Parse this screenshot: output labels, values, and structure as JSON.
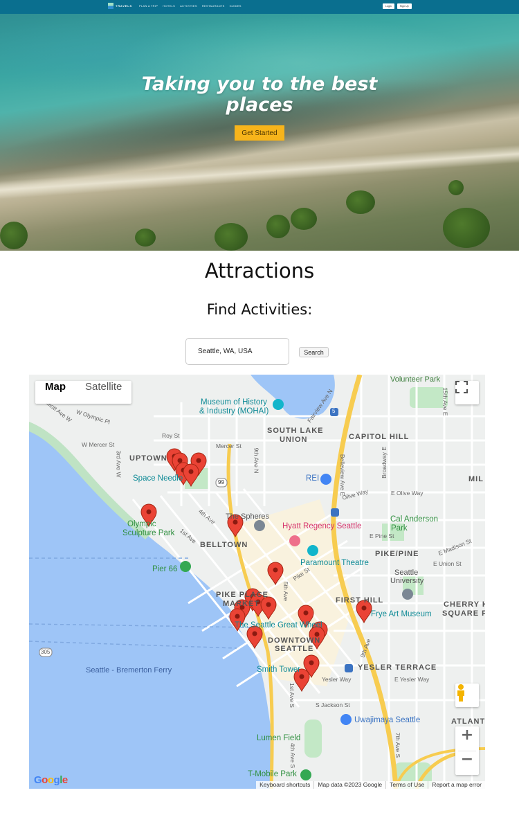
{
  "nav": {
    "brand": "TRAVELS",
    "links": [
      "PLAN A TRIP",
      "HOTELS",
      "ACTIVITIES",
      "RESTAURANTS",
      "GUIDES"
    ],
    "login": "Login",
    "signup": "Sign Up"
  },
  "hero": {
    "headline_line1": "Taking you to the best",
    "headline_line2": "places",
    "cta": "Get Started"
  },
  "attractions": {
    "title": "Attractions",
    "subtitle": "Find Activities:",
    "search_value": "Seattle, WA, USA",
    "search_button": "Search"
  },
  "map": {
    "type_map": "Map",
    "type_satellite": "Satellite",
    "google": [
      "G",
      "o",
      "o",
      "g",
      "l",
      "e"
    ],
    "google_colors": [
      "#4285F4",
      "#EA4335",
      "#FBBC05",
      "#4285F4",
      "#34A853",
      "#EA4335"
    ],
    "attribution": [
      "Keyboard shortcuts",
      "Map data ©2023 Google",
      "Terms of Use",
      "Report a map error"
    ],
    "zoom_in": "+",
    "zoom_out": "−",
    "marker_color": "#ea4335",
    "labels": {
      "volunteer_park": "Volunteer Park",
      "museum_line1": "Museum of History",
      "museum_line2": "& Industry (MOHAI)",
      "south_lake_union_1": "SOUTH LAKE",
      "south_lake_union_2": "UNION",
      "capitol_hill": "CAPITOL HILL",
      "uptown": "UPTOWN",
      "space_needle": "Space Needle",
      "roy_st": "Roy St",
      "mercer_st": "Mercer St",
      "w_mercer_st": "W Mercer St",
      "w_olympic_pl": "W Olympic Pl",
      "elliott_ave": "Elliott Ave W",
      "third_ave_w": "3rd Ave W",
      "ninth_ave_n": "9th Ave N",
      "fairview": "Fairview Ave N",
      "belleview": "Belleview Ave E",
      "broadway": "Broadway E",
      "fifteenth": "15th Ave E",
      "e_olive_way": "E Olive Way",
      "olive_way": "Olive Way",
      "e_pine_st": "E Pine St",
      "rei": "REI",
      "mil": "MIL",
      "olympic_1": "Olympic",
      "olympic_2": "Sculpture Park",
      "the_spheres": "The Spheres",
      "fourth_ave": "4th Ave",
      "first_ave": "1st Ave",
      "hyatt": "Hyatt Regency Seattle",
      "cal_anderson_1": "Cal Anderson",
      "cal_anderson_2": "Park",
      "belltown": "BELLTOWN",
      "pike_pine": "PIKE/PINE",
      "e_madison": "E Madison St",
      "e_union": "E Union St",
      "pier66": "Pier 66",
      "paramount": "Paramount Theatre",
      "seattle_univ_1": "Seattle",
      "seattle_univ_2": "University",
      "pike_st": "Pike St",
      "fifth_ave": "5th Ave",
      "pike_place_1": "PIKE PLACE",
      "pike_place_2": "MARKET",
      "first_hill": "FIRST HILL",
      "frye": "Frye Art Museum",
      "cherry_hill_1": "CHERRY H",
      "cherry_hill_2": "SQUARE PA",
      "great_wheel": "The Seattle Great Wheel",
      "downtown_1": "DOWNTOWN",
      "downtown_2": "SEATTLE",
      "ninth_ave": "9th Ave",
      "hwy305": "305",
      "ferry": "Seattle - Bremerton Ferry",
      "smith_tower": "Smith Tower",
      "yesler_terrace": "YESLER TERRACE",
      "yesler_way": "Yesler Way",
      "e_yesler_way": "E Yesler Way",
      "first_ave_s": "1st Ave S",
      "s_jackson": "S Jackson St",
      "uwajimaya": "Uwajimaya Seattle",
      "atlanti": "ATLANTI",
      "lumen": "Lumen Field",
      "tmobile": "T-Mobile Park",
      "fourth_ave_s": "4th Ave S",
      "seventh_ave_s": "7th Ave S",
      "hwy99": "99",
      "hwy5": "5"
    }
  }
}
